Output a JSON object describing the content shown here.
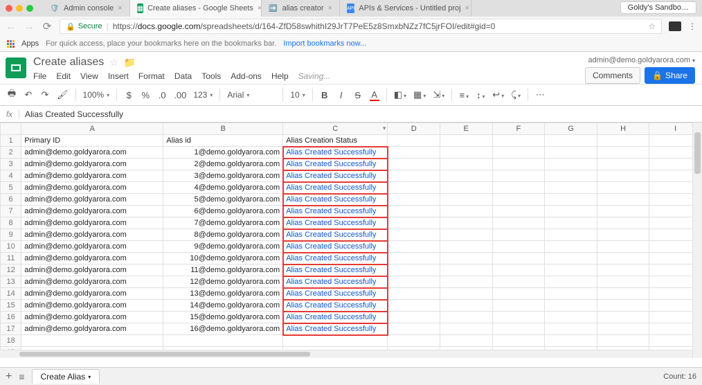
{
  "browser": {
    "profile": "Goldy's Sandbo…",
    "tabs": [
      {
        "title": "Admin console",
        "favicon": "🛡️"
      },
      {
        "title": "Create aliases - Google Sheets",
        "favicon": "sheets",
        "active": true
      },
      {
        "title": "alias creator",
        "favicon": "➡️"
      },
      {
        "title": "APIs & Services - Untitled proj",
        "favicon": "API"
      }
    ],
    "secure_label": "Secure",
    "url_prefix": "https://",
    "url_host": "docs.google.com",
    "url_path": "/spreadsheets/d/164-ZfD58swhithI29JrT7PeE5z8SmxbNZz7fC5jrFOI/edit#gid=0",
    "apps_label": "Apps",
    "apps_hint": "For quick access, place your bookmarks here on the bookmarks bar.",
    "import_link": "Import bookmarks now..."
  },
  "sheets": {
    "doc_title": "Create aliases",
    "user_email": "admin@demo.goldyarora.com",
    "comments_btn": "Comments",
    "share_btn": "Share",
    "saving": "Saving...",
    "menus": [
      "File",
      "Edit",
      "View",
      "Insert",
      "Format",
      "Data",
      "Tools",
      "Add-ons",
      "Help"
    ],
    "toolbar": {
      "zoom": "100%",
      "num_format": "123",
      "font": "Arial",
      "font_size": "10",
      "more": "More"
    },
    "formula_bar": "Alias Created Successfully",
    "columns": [
      "A",
      "B",
      "C",
      "D",
      "E",
      "F",
      "G",
      "H",
      "I"
    ],
    "headers": {
      "A": "Primary ID",
      "B": "Alias id",
      "C": "Alias Creation Status"
    },
    "rows": [
      {
        "a": "admin@demo.goldyarora.com",
        "b": "1@demo.goldyarora.com",
        "c": "Alias Created Successfully"
      },
      {
        "a": "admin@demo.goldyarora.com",
        "b": "2@demo.goldyarora.com",
        "c": "Alias Created Successfully"
      },
      {
        "a": "admin@demo.goldyarora.com",
        "b": "3@demo.goldyarora.com",
        "c": "Alias Created Successfully"
      },
      {
        "a": "admin@demo.goldyarora.com",
        "b": "4@demo.goldyarora.com",
        "c": "Alias Created Successfully"
      },
      {
        "a": "admin@demo.goldyarora.com",
        "b": "5@demo.goldyarora.com",
        "c": "Alias Created Successfully"
      },
      {
        "a": "admin@demo.goldyarora.com",
        "b": "6@demo.goldyarora.com",
        "c": "Alias Created Successfully"
      },
      {
        "a": "admin@demo.goldyarora.com",
        "b": "7@demo.goldyarora.com",
        "c": "Alias Created Successfully"
      },
      {
        "a": "admin@demo.goldyarora.com",
        "b": "8@demo.goldyarora.com",
        "c": "Alias Created Successfully"
      },
      {
        "a": "admin@demo.goldyarora.com",
        "b": "9@demo.goldyarora.com",
        "c": "Alias Created Successfully"
      },
      {
        "a": "admin@demo.goldyarora.com",
        "b": "10@demo.goldyarora.com",
        "c": "Alias Created Successfully"
      },
      {
        "a": "admin@demo.goldyarora.com",
        "b": "11@demo.goldyarora.com",
        "c": "Alias Created Successfully"
      },
      {
        "a": "admin@demo.goldyarora.com",
        "b": "12@demo.goldyarora.com",
        "c": "Alias Created Successfully"
      },
      {
        "a": "admin@demo.goldyarora.com",
        "b": "13@demo.goldyarora.com",
        "c": "Alias Created Successfully"
      },
      {
        "a": "admin@demo.goldyarora.com",
        "b": "14@demo.goldyarora.com",
        "c": "Alias Created Successfully"
      },
      {
        "a": "admin@demo.goldyarora.com",
        "b": "15@demo.goldyarora.com",
        "c": "Alias Created Successfully"
      },
      {
        "a": "admin@demo.goldyarora.com",
        "b": "16@demo.goldyarora.com",
        "c": "Alias Created Successfully"
      }
    ],
    "sheet_tab": "Create Alias",
    "count_label": "Count: 16"
  }
}
